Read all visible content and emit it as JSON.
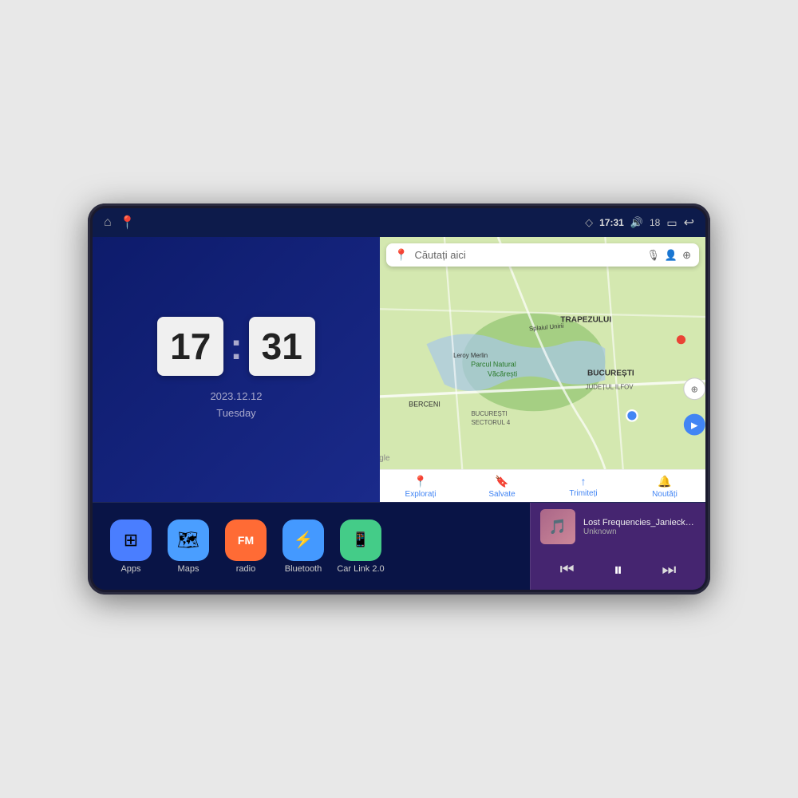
{
  "device": {
    "status_bar": {
      "nav_home": "⌂",
      "nav_maps": "📍",
      "gps_icon": "◇",
      "time": "17:31",
      "volume_icon": "🔊",
      "volume_level": "18",
      "battery_icon": "▭",
      "back_icon": "↩"
    },
    "clock": {
      "hour": "17",
      "minute": "31",
      "date": "2023.12.12",
      "day": "Tuesday"
    },
    "map": {
      "search_placeholder": "Căutați aici",
      "tabs": [
        {
          "label": "Explorați",
          "icon": "📍"
        },
        {
          "label": "Salvate",
          "icon": "🔖"
        },
        {
          "label": "Trimiteți",
          "icon": "↑"
        },
        {
          "label": "Noutăți",
          "icon": "🔔"
        }
      ]
    },
    "apps": [
      {
        "id": "apps",
        "label": "Apps",
        "icon": "⊞",
        "color_class": "app-icon-apps"
      },
      {
        "id": "maps",
        "label": "Maps",
        "icon": "🗺",
        "color_class": "app-icon-maps"
      },
      {
        "id": "radio",
        "label": "radio",
        "icon": "📻",
        "color_class": "app-icon-radio"
      },
      {
        "id": "bluetooth",
        "label": "Bluetooth",
        "icon": "⚡",
        "color_class": "app-icon-bluetooth"
      },
      {
        "id": "carlink",
        "label": "Car Link 2.0",
        "icon": "📱",
        "color_class": "app-icon-carlink"
      }
    ],
    "music": {
      "title": "Lost Frequencies_Janieck Devy-...",
      "artist": "Unknown",
      "prev_icon": "⏮",
      "play_icon": "⏸",
      "next_icon": "⏭"
    }
  }
}
